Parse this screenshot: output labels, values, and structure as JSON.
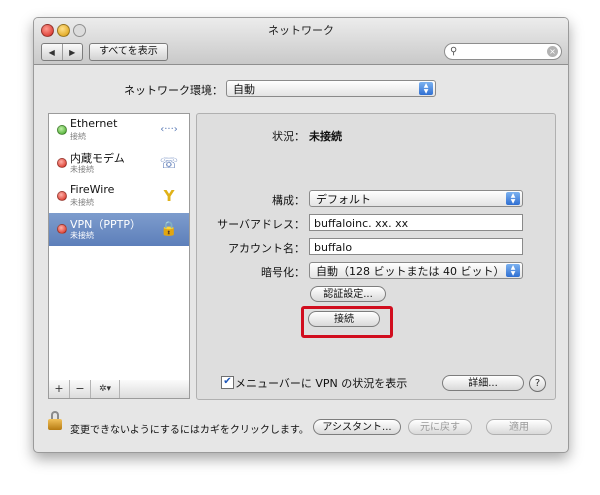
{
  "window": {
    "title": "ネットワーク"
  },
  "toolbar": {
    "back_glyph": "◀",
    "forward_glyph": "▶",
    "show_all_label": "すべてを表示",
    "search_value": "",
    "search_icon": "magnifier-icon",
    "clear_glyph": "×"
  },
  "location": {
    "label": "ネットワーク環境：",
    "value": "自動"
  },
  "services": [
    {
      "name": "Ethernet",
      "status": "接続",
      "status_color": "green",
      "icon": "ethernet-icon",
      "glyph": "‹···›"
    },
    {
      "name": "内蔵モデム",
      "status": "未接続",
      "status_color": "red",
      "icon": "phone-icon",
      "glyph": "☏"
    },
    {
      "name": "FireWire",
      "status": "未接続",
      "status_color": "red",
      "icon": "firewire-icon",
      "glyph": "Y"
    },
    {
      "name": "VPN（PPTP）",
      "status": "未接続",
      "status_color": "red",
      "icon": "vpn-lock-icon",
      "glyph": "🔒",
      "selected": true
    }
  ],
  "list_toolbar": {
    "add": "+",
    "remove": "−",
    "gear": "✲▾"
  },
  "detail": {
    "status_label": "状況：",
    "status_value": "未接続",
    "config_label": "構成：",
    "config_value": "デフォルト",
    "server_label": "サーバアドレス：",
    "server_value": "buffaloinc. xx. xx",
    "account_label": "アカウント名：",
    "account_value": "buffalo",
    "encryption_label": "暗号化：",
    "encryption_value": "自動（128 ビットまたは 40 ビット）",
    "auth_button": "認証設定...",
    "connect_button": "接続",
    "menubar_checkbox_label": "メニューバーに VPN の状況を表示",
    "menubar_checked": true,
    "check_glyph": "✔",
    "advanced_button": "詳細...",
    "help_glyph": "?"
  },
  "footer": {
    "lock_text": "変更できないようにするにはカギをクリックします。",
    "assistant_button": "アシスタント...",
    "revert_button": "元に戻す",
    "apply_button": "適用"
  },
  "colors": {
    "highlight": "#d10d1e",
    "selection": "#6f8fc6",
    "accent": "#2f6fd2"
  }
}
